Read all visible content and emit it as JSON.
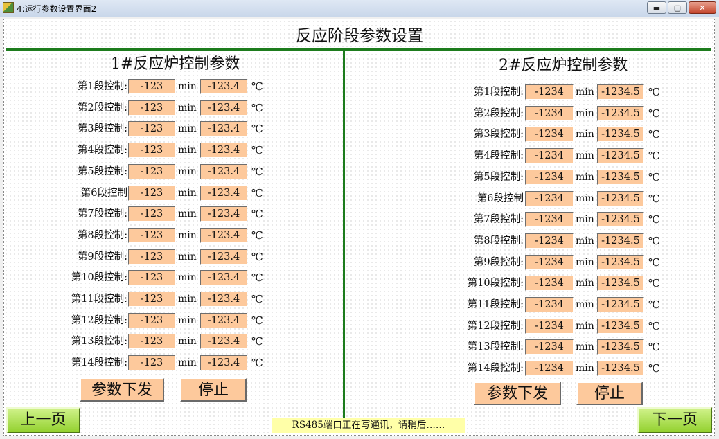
{
  "window": {
    "title": "4:运行参数设置界面2",
    "min_glyph": "▬",
    "max_glyph": "▢",
    "close_glyph": "✕"
  },
  "page_title": "反应阶段参数设置",
  "left_panel": {
    "title": "1#反应炉控制参数",
    "unit_time": "min",
    "unit_temp": "℃",
    "rows": [
      {
        "label": "第1段控制:",
        "time": "-123",
        "temp": "-123.4"
      },
      {
        "label": "第2段控制:",
        "time": "-123",
        "temp": "-123.4"
      },
      {
        "label": "第3段控制:",
        "time": "-123",
        "temp": "-123.4"
      },
      {
        "label": "第4段控制:",
        "time": "-123",
        "temp": "-123.4"
      },
      {
        "label": "第5段控制:",
        "time": "-123",
        "temp": "-123.4"
      },
      {
        "label": "第6段控制",
        "time": "-123",
        "temp": "-123.4"
      },
      {
        "label": "第7段控制:",
        "time": "-123",
        "temp": "-123.4"
      },
      {
        "label": "第8段控制:",
        "time": "-123",
        "temp": "-123.4"
      },
      {
        "label": "第9段控制:",
        "time": "-123",
        "temp": "-123.4"
      },
      {
        "label": "第10段控制:",
        "time": "-123",
        "temp": "-123.4"
      },
      {
        "label": "第11段控制:",
        "time": "-123",
        "temp": "-123.4"
      },
      {
        "label": "第12段控制:",
        "time": "-123",
        "temp": "-123.4"
      },
      {
        "label": "第13段控制:",
        "time": "-123",
        "temp": "-123.4"
      },
      {
        "label": "第14段控制:",
        "time": "-123",
        "temp": "-123.4"
      }
    ],
    "send_label": "参数下发",
    "stop_label": "停止"
  },
  "right_panel": {
    "title": "2#反应炉控制参数",
    "unit_time": "min",
    "unit_temp": "℃",
    "rows": [
      {
        "label": "第1段控制:",
        "time": "-1234",
        "temp": "-1234.5"
      },
      {
        "label": "第2段控制:",
        "time": "-1234",
        "temp": "-1234.5"
      },
      {
        "label": "第3段控制:",
        "time": "-1234",
        "temp": "-1234.5"
      },
      {
        "label": "第4段控制:",
        "time": "-1234",
        "temp": "-1234.5"
      },
      {
        "label": "第5段控制:",
        "time": "-1234",
        "temp": "-1234.5"
      },
      {
        "label": "第6段控制",
        "time": "-1234",
        "temp": "-1234.5"
      },
      {
        "label": "第7段控制:",
        "time": "-1234",
        "temp": "-1234.5"
      },
      {
        "label": "第8段控制:",
        "time": "-1234",
        "temp": "-1234.5"
      },
      {
        "label": "第9段控制:",
        "time": "-1234",
        "temp": "-1234.5"
      },
      {
        "label": "第10段控制:",
        "time": "-1234",
        "temp": "-1234.5"
      },
      {
        "label": "第11段控制:",
        "time": "-1234",
        "temp": "-1234.5"
      },
      {
        "label": "第12段控制:",
        "time": "-1234",
        "temp": "-1234.5"
      },
      {
        "label": "第13段控制:",
        "time": "-1234",
        "temp": "-1234.5"
      },
      {
        "label": "第14段控制:",
        "time": "-1234",
        "temp": "-1234.5"
      }
    ],
    "send_label": "参数下发",
    "stop_label": "停止"
  },
  "nav": {
    "prev_label": "上一页",
    "next_label": "下一页"
  },
  "status_text": "RS485端口正在写通讯，请稍后……",
  "colors": {
    "field_bg": "#fdc99c",
    "divider": "#1d7c1d",
    "nav_button": "#93d12f",
    "status_bg": "#ffffa8"
  }
}
